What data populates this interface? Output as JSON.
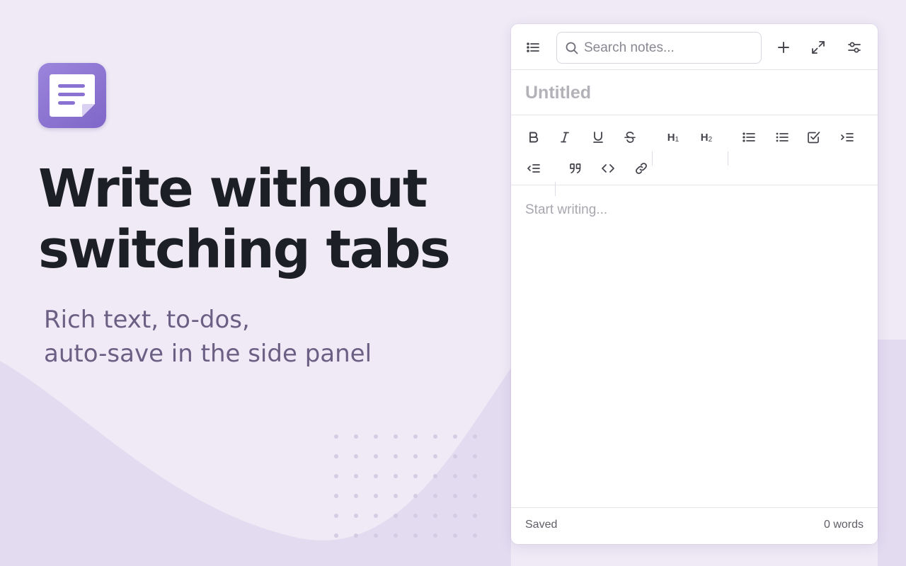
{
  "hero": {
    "headline_line1": "Write without",
    "headline_line2": "switching tabs",
    "subhead_line1": "Rich text, to-dos,",
    "subhead_line2": "auto-save in the side panel",
    "logo_icon": "note-icon"
  },
  "panel": {
    "search": {
      "placeholder": "Search notes..."
    },
    "topbar_icons": [
      "menu-icon",
      "search-icon",
      "plus-icon",
      "expand-icon",
      "settings-sliders-icon"
    ],
    "title": {
      "placeholder": "Untitled",
      "value": ""
    },
    "toolbar": {
      "h1": "H",
      "h1_sub": "1",
      "h2": "H",
      "h2_sub": "2",
      "icons": [
        "bold-icon",
        "italic-icon",
        "underline-icon",
        "strikethrough-icon",
        "heading-1-icon",
        "heading-2-icon",
        "bullet-list-icon",
        "numbered-list-icon",
        "checklist-icon",
        "indent-icon",
        "outdent-icon",
        "blockquote-icon",
        "code-icon",
        "link-icon"
      ]
    },
    "editor": {
      "placeholder": "Start writing..."
    },
    "status": {
      "saved": "Saved",
      "word_count": "0 words"
    }
  },
  "colors": {
    "background": "#efeaf6",
    "accent": "#8a72d2",
    "headline": "#1d1f26",
    "subhead": "#6b5f84"
  }
}
